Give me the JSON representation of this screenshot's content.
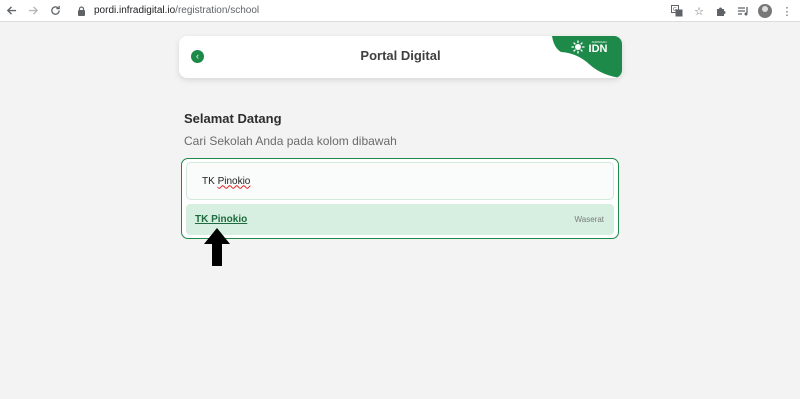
{
  "browser": {
    "url_host": "pordi.infradigital.io",
    "url_path": "/registration/school"
  },
  "header": {
    "title": "Portal Digital",
    "badge_small": "JARINGAN",
    "badge_big": "IDN"
  },
  "welcome": {
    "title": "Selamat Datang",
    "subtitle": "Cari Sekolah Anda pada kolom dibawah"
  },
  "search": {
    "value_prefix": "TK ",
    "value_word": "Pinokio"
  },
  "results": [
    {
      "name": "TK Pinokio",
      "location": "Waserat"
    }
  ],
  "colors": {
    "brand_green": "#1d8a4a",
    "result_bg": "#d7efe1"
  },
  "icons": {
    "back": "back-arrow-icon",
    "lock": "lock-icon",
    "translate": "translate-icon",
    "star": "star-icon",
    "extensions": "puzzle-icon",
    "media": "playlist-icon",
    "menu": "kebab-menu-icon"
  }
}
